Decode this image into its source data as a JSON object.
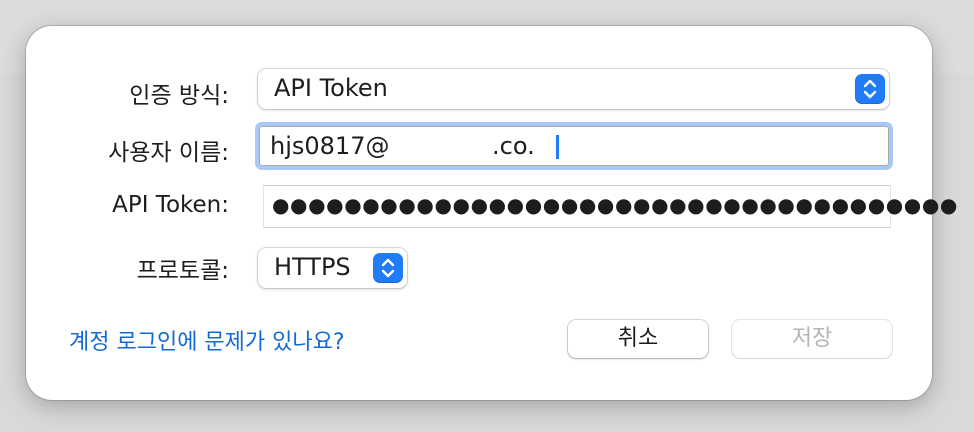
{
  "dialog": {
    "auth_method": {
      "label": "인증 방식:",
      "value": "API Token"
    },
    "username": {
      "label": "사용자 이름:",
      "value_prefix": "hjs0817@",
      "value_suffix": ".co.",
      "focused": true
    },
    "api_token": {
      "label": "API Token:",
      "masked_value": "●●●●●●●●●●●●●●●●●●●●●●●●●●●●●●●●●●●●●●"
    },
    "protocol": {
      "label": "프로토콜:",
      "value": "HTTPS"
    },
    "help_link": "계정 로그인에 문제가 있나요?",
    "buttons": {
      "cancel": "취소",
      "save": "저장",
      "save_enabled": false
    }
  },
  "colors": {
    "accent": "#1f7bf6",
    "link": "#1469d6",
    "focus_ring": "#a9c8f5",
    "disabled_text": "#b5b5b5"
  },
  "icons": {
    "popup_stepper": "chevron-up-down-icon"
  }
}
